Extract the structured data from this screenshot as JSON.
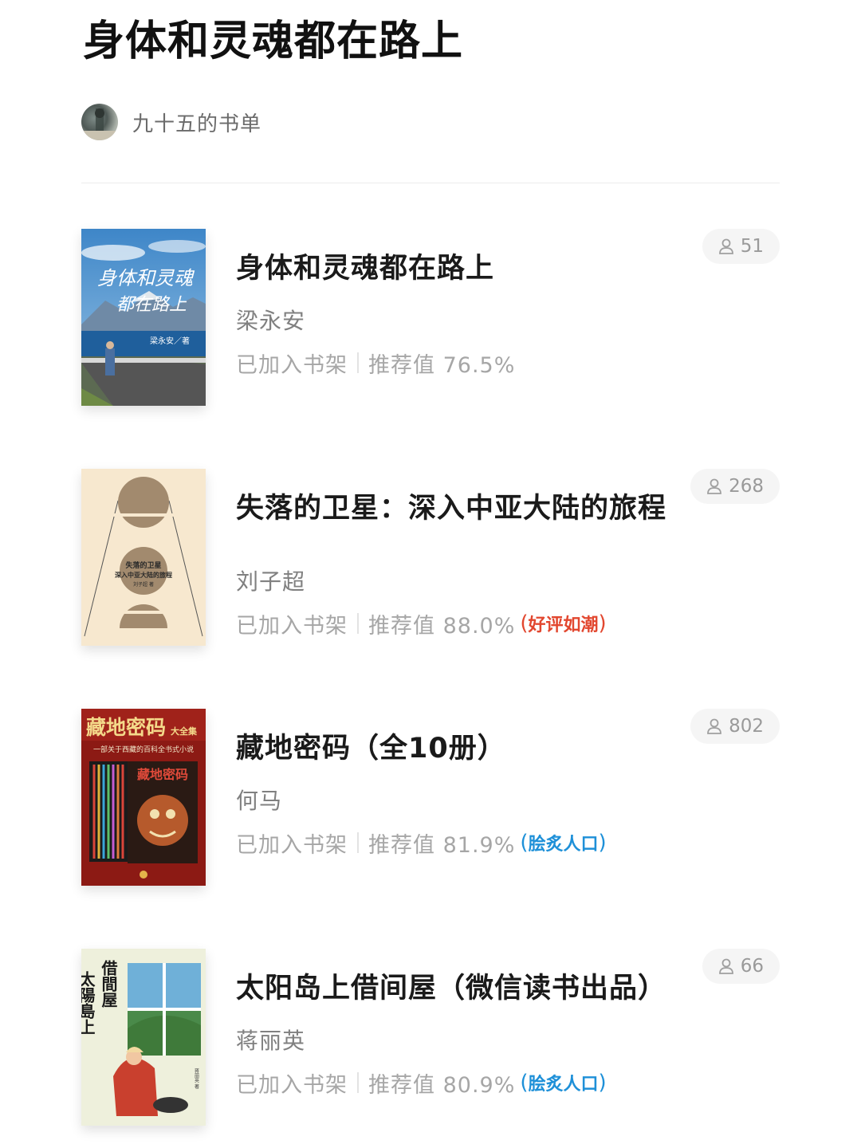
{
  "page": {
    "title": "身体和灵魂都在路上"
  },
  "owner": {
    "name": "九十五的书单",
    "avatar": "avatar-photo"
  },
  "icons": {
    "readers": "person-icon",
    "badge_wreath": "laurel-icon"
  },
  "colors": {
    "badge_red": "#e2472f",
    "badge_blue": "#1e90d8",
    "meta_gray": "#a6a6a6"
  },
  "books": [
    {
      "title": "身体和灵魂都在路上",
      "author": "梁永安",
      "shelf_label": "已加入书架",
      "recommend": "推荐值 76.5%",
      "readers": "51",
      "badge": "",
      "cover": {
        "title_line1": "身体和灵魂",
        "title_line2": "都在路上",
        "author": "梁永安／著"
      }
    },
    {
      "title": "失落的卫星：深入中亚大陆的旅程",
      "author": "刘子超",
      "shelf_label": "已加入书架",
      "recommend": "推荐值 88.0%",
      "readers": "268",
      "badge": "好评如潮",
      "cover": {
        "title_line1": "失落的卫星",
        "title_line2": "深入中亚大陆的旅程",
        "author": "刘子超 著"
      }
    },
    {
      "title": "藏地密码（全10册）",
      "author": "何马",
      "shelf_label": "已加入书架",
      "recommend": "推荐值 81.9%",
      "readers": "802",
      "badge": "脍炙人口",
      "cover": {
        "title": "藏地密码",
        "suffix": "大全集",
        "subtitle": "一部关于西藏的百科全书式小说",
        "inner_title": "藏地密码"
      }
    },
    {
      "title": "太阳岛上借间屋（微信读书出品）",
      "author": "蒋丽英",
      "shelf_label": "已加入书架",
      "recommend": "推荐值 80.9%",
      "readers": "66",
      "badge": "脍炙人口",
      "cover": {
        "title_a": "太陽島上",
        "title_b": "借間屋",
        "author": "蒋丽英 著"
      }
    }
  ]
}
